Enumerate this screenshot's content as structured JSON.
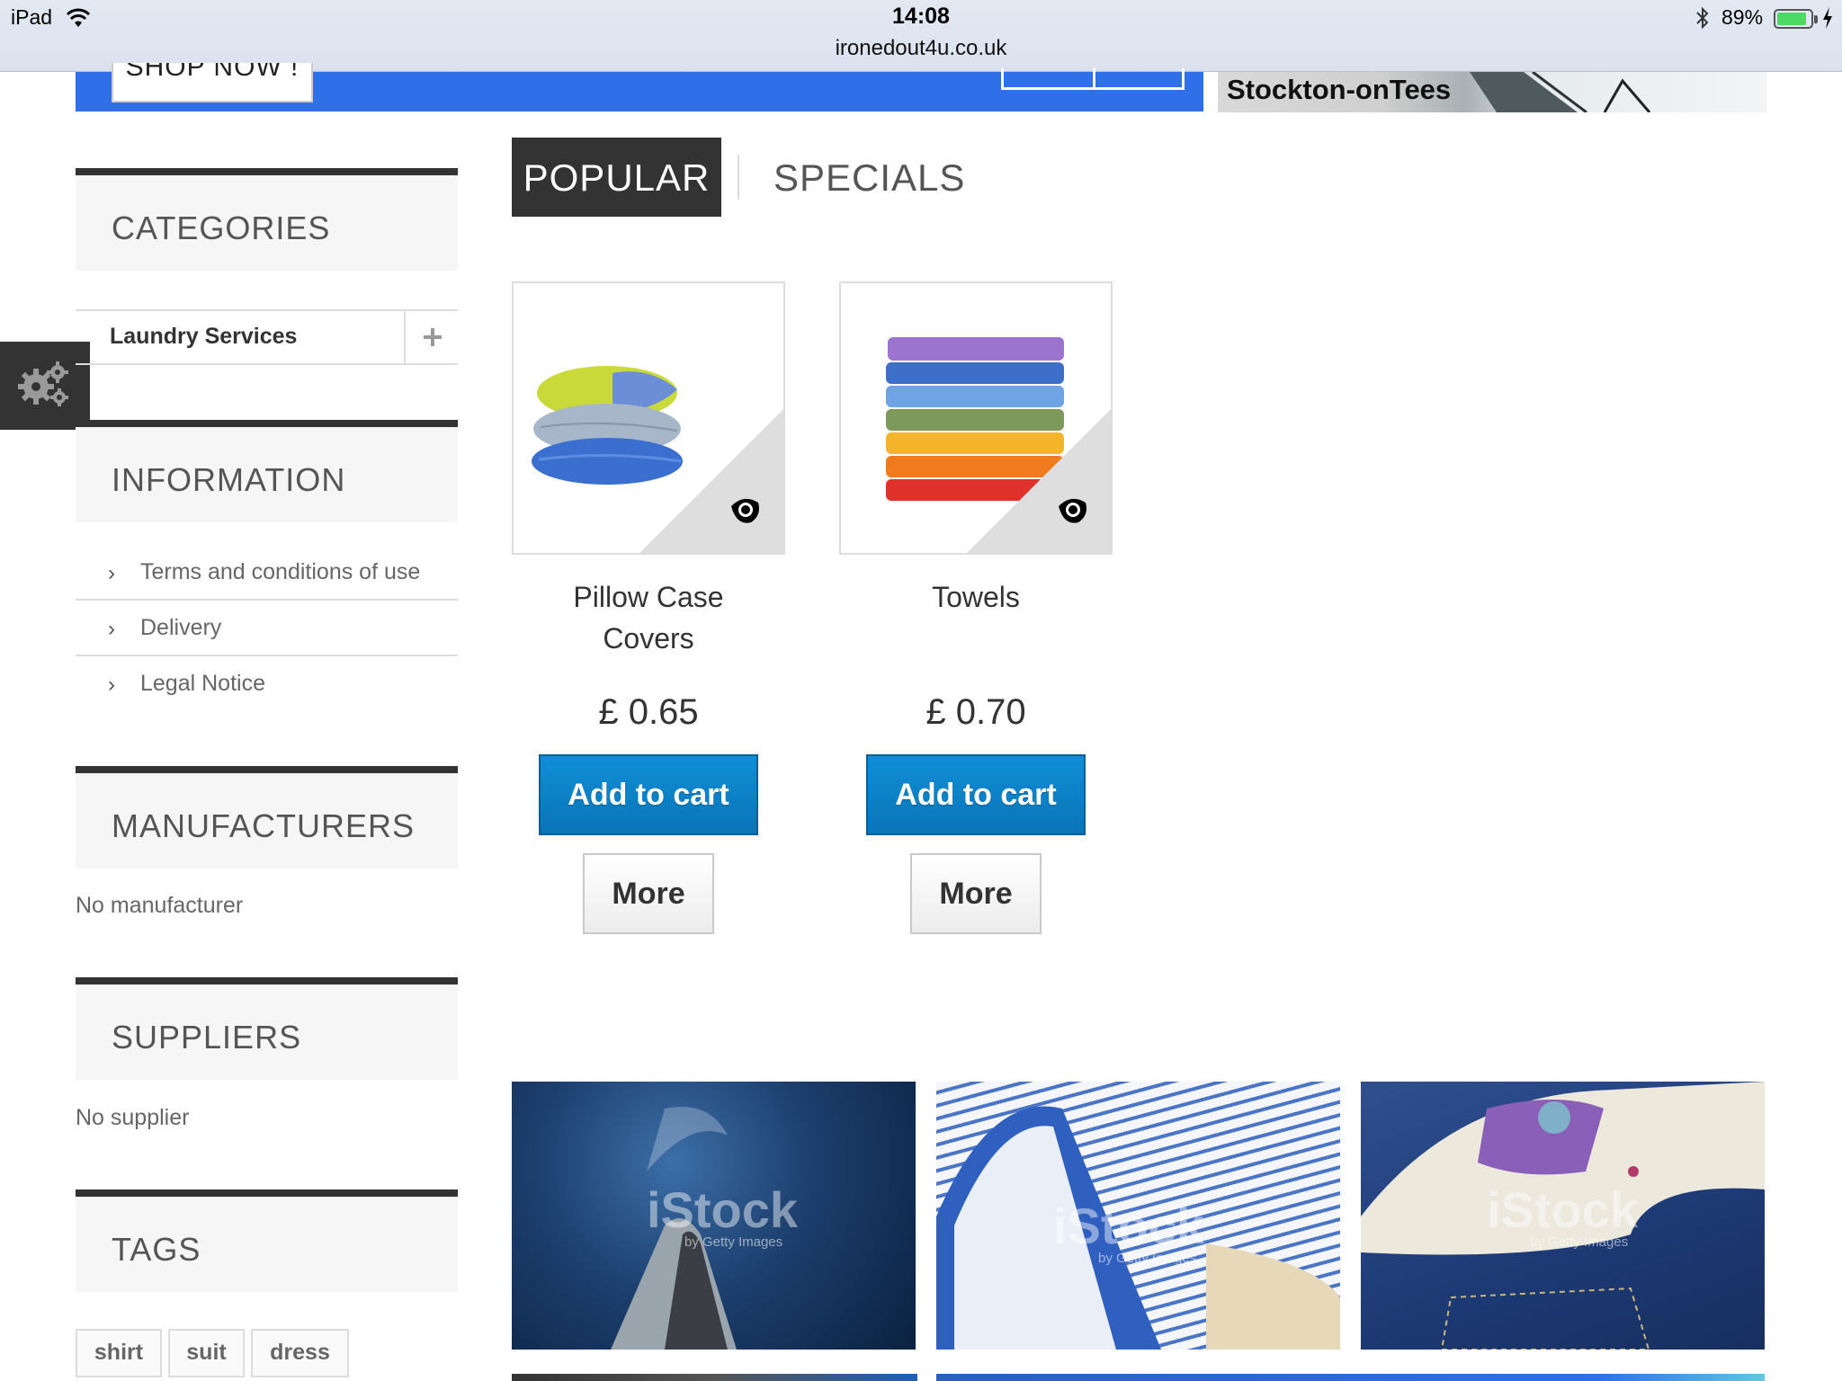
{
  "status_bar": {
    "device": "iPad",
    "time": "14:08",
    "url": "ironedout4u.co.uk",
    "battery": "89%",
    "battery_level": 0.89,
    "icons": [
      "wifi-icon",
      "bluetooth-icon",
      "battery-icon",
      "charging-bolt-icon"
    ]
  },
  "hero": {
    "shop_now_label": "SHOP NOW !",
    "location_text": "Stockton-onTees",
    "accent_color": "#2f6fe8"
  },
  "sidebar": {
    "categories": {
      "title": "CATEGORIES",
      "items": [
        {
          "label": "Laundry Services"
        }
      ]
    },
    "information": {
      "title": "INFORMATION",
      "links": [
        {
          "label": "Terms and conditions of use"
        },
        {
          "label": "Delivery"
        },
        {
          "label": "Legal Notice"
        }
      ]
    },
    "manufacturers": {
      "title": "MANUFACTURERS",
      "empty_text": "No manufacturer"
    },
    "suppliers": {
      "title": "SUPPLIERS",
      "empty_text": "No supplier"
    },
    "tags": {
      "title": "TAGS",
      "items": [
        "shirt",
        "suit",
        "dress"
      ]
    }
  },
  "tabs": {
    "active": "POPULAR",
    "items": [
      {
        "label": "POPULAR"
      },
      {
        "label": "SPECIALS"
      }
    ]
  },
  "products": [
    {
      "name_line1": "Pillow Case",
      "name_line2": "Covers",
      "price": "£ 0.65",
      "add_to_cart_label": "Add to cart",
      "more_label": "More"
    },
    {
      "name_line1": "Towels",
      "price": "£ 0.70",
      "add_to_cart_label": "Add to cart",
      "more_label": "More"
    }
  ],
  "banners": [
    {
      "watermark": "iStock",
      "watermark_sub": "by Getty Images"
    },
    {
      "watermark": "iStock",
      "watermark_sub": "by Getty Images"
    },
    {
      "watermark": "iStock",
      "watermark_sub": "by Getty Images"
    }
  ],
  "colors": {
    "button_blue": "#0a74b8",
    "header_dark": "#333333",
    "link_gray": "#666666"
  }
}
